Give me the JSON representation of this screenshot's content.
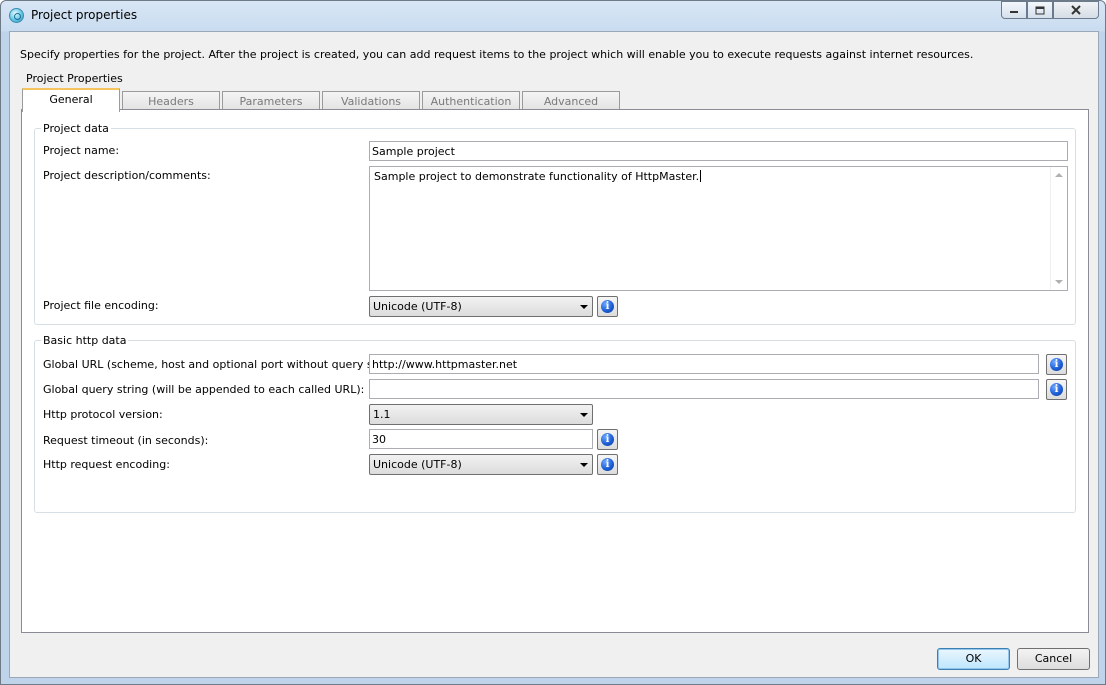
{
  "window": {
    "title": "Project properties",
    "app_icon": "httpmaster-icon",
    "controls": {
      "minimize": "minimize-icon",
      "maximize": "maximize-icon",
      "close": "close-icon"
    }
  },
  "intro_text": "Specify properties for the project. After the project is created, you can add request items to the project which will enable you to execute requests against internet resources.",
  "section_label": "Project Properties",
  "tabs": [
    {
      "label": "General",
      "active": true
    },
    {
      "label": "Headers",
      "active": false
    },
    {
      "label": "Parameters",
      "active": false
    },
    {
      "label": "Validations",
      "active": false
    },
    {
      "label": "Authentication",
      "active": false
    },
    {
      "label": "Advanced",
      "active": false
    }
  ],
  "project_data": {
    "title": "Project data",
    "name_label": "Project name:",
    "name_value": "Sample project",
    "description_label": "Project description/comments:",
    "description_value": "Sample project to demonstrate functionality of HttpMaster.",
    "encoding_label": "Project file encoding:",
    "encoding_value": "Unicode (UTF-8)"
  },
  "basic_http": {
    "title": "Basic http data",
    "global_url_label": "Global URL (scheme, host and optional port without query string):",
    "global_url_value": "http://www.httpmaster.net",
    "query_label": "Global query string (will be appended to each called URL):",
    "query_value": "",
    "protocol_label": "Http protocol version:",
    "protocol_value": "1.1",
    "timeout_label": "Request timeout (in seconds):",
    "timeout_value": "30",
    "request_encoding_label": "Http request encoding:",
    "request_encoding_value": "Unicode (UTF-8)"
  },
  "buttons": {
    "ok": "OK",
    "cancel": "Cancel"
  },
  "colors": {
    "active_tab_accent": "#f5c45d",
    "info_icon": "#1d5fd6",
    "titlebar": "#c9dcf0"
  }
}
